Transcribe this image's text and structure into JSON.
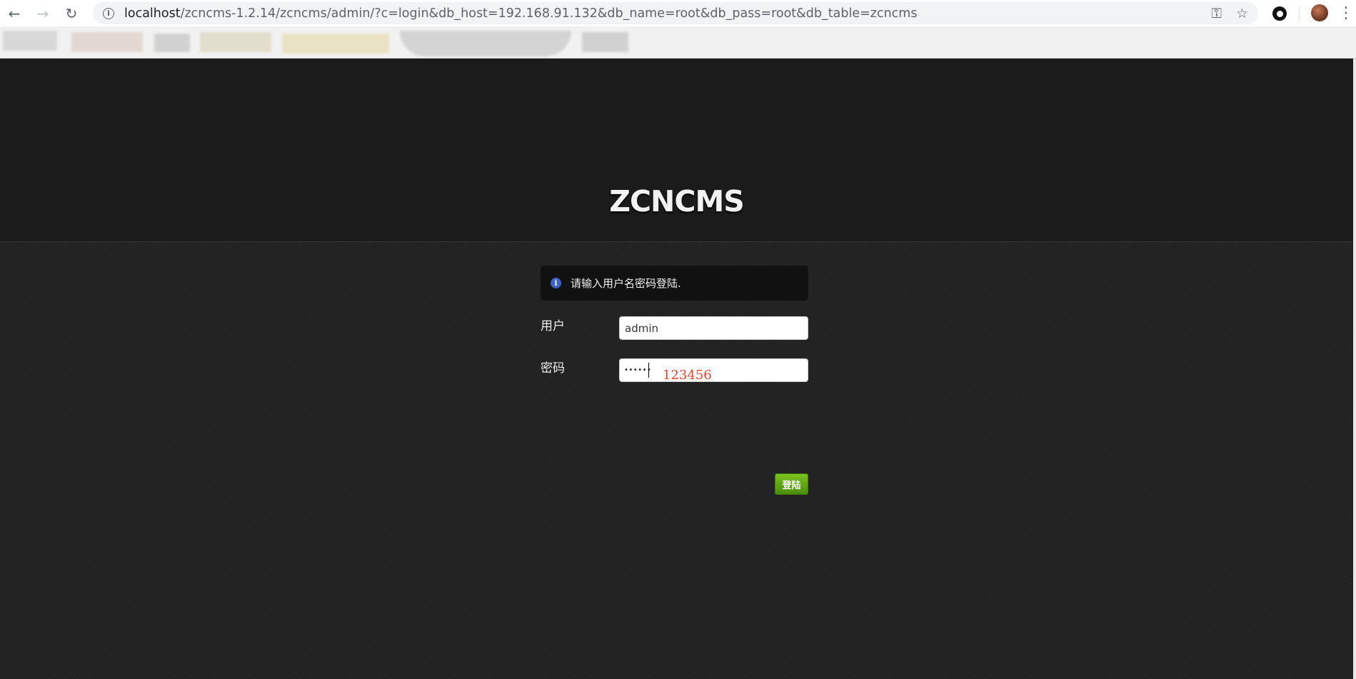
{
  "browser": {
    "url_host": "localhost",
    "url_path": "/zcncms-1.2.14/zcncms/admin/?c=login&db_host=192.168.91.132&db_name=root&db_pass=root&db_table=zcncms"
  },
  "page": {
    "logo": "ZCNCMS",
    "notice": "请输入用户名密码登陆.",
    "username_label": "用户",
    "username_value": "admin",
    "password_label": "密码",
    "password_masked": "••••••",
    "password_annotation": "123456",
    "submit_label": "登陆"
  },
  "colors": {
    "submit": "#5aa614",
    "annotation": "#e8432d",
    "notice_icon": "#3b63c4"
  }
}
